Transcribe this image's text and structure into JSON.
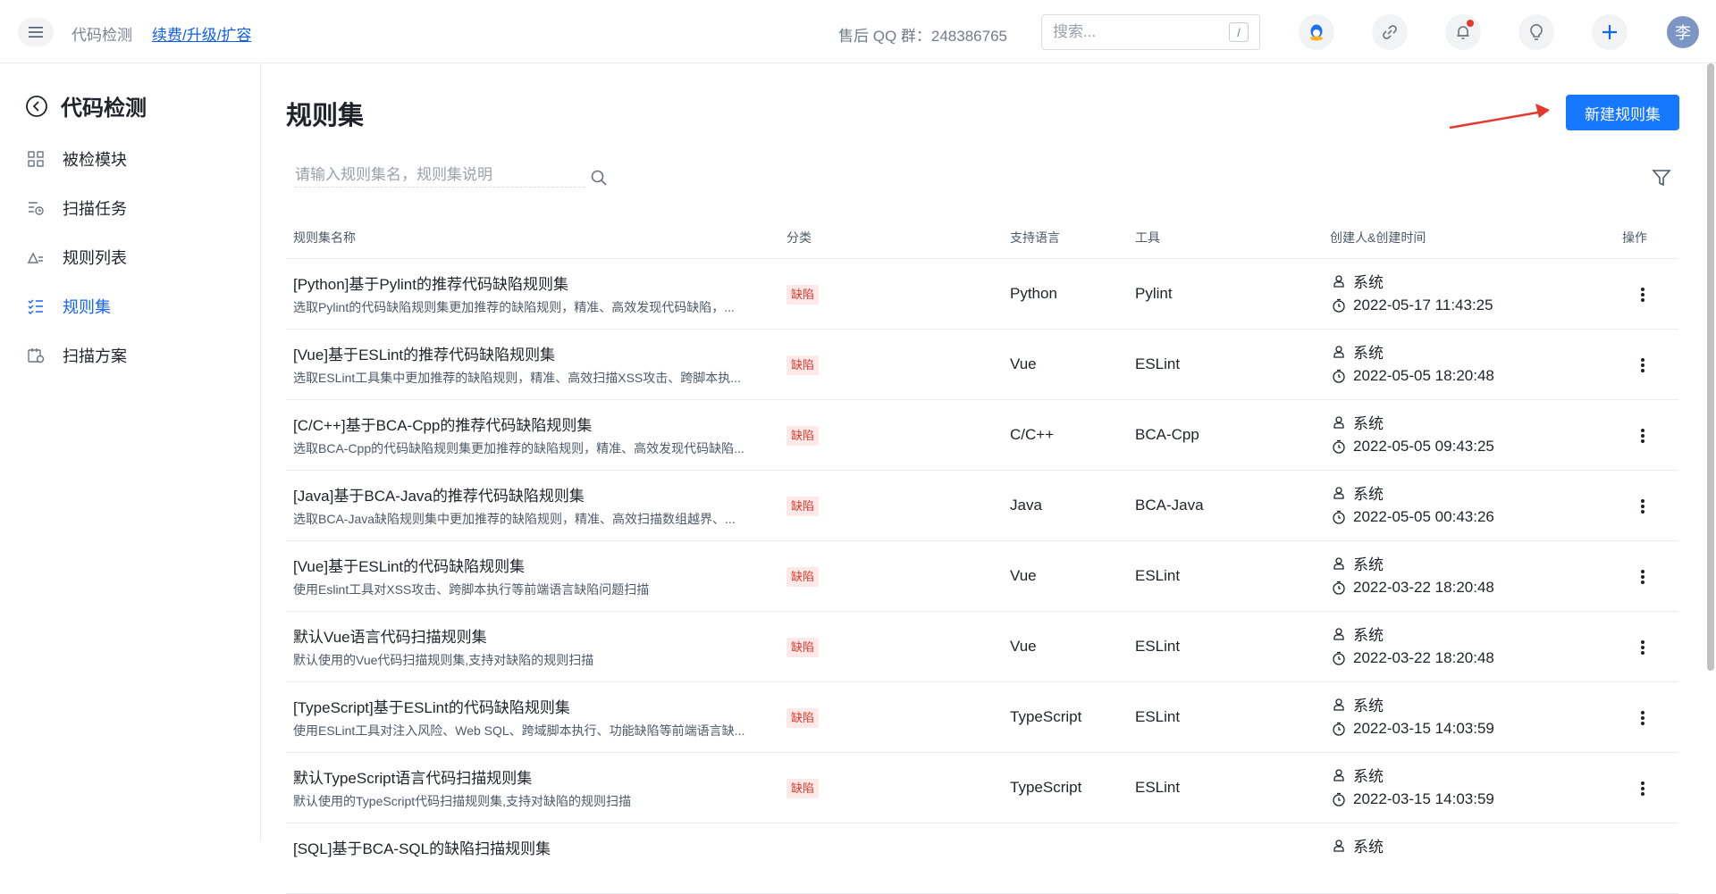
{
  "header": {
    "breadcrumb_root": "代码检测",
    "breadcrumb_link": "续费/升级/扩容",
    "qq_group": "售后 QQ 群：248386765",
    "search_placeholder": "搜索...",
    "search_shortcut": "/",
    "avatar_text": "李",
    "icons": [
      "qq-icon",
      "link-icon",
      "bell-icon",
      "bulb-icon",
      "plus-icon"
    ]
  },
  "sidebar": {
    "title": "代码检测",
    "items": [
      {
        "label": "被检模块",
        "icon": "grid-icon"
      },
      {
        "label": "扫描任务",
        "icon": "task-icon"
      },
      {
        "label": "规则列表",
        "icon": "rules-icon"
      },
      {
        "label": "规则集",
        "icon": "ruleset-icon",
        "active": true
      },
      {
        "label": "扫描方案",
        "icon": "plan-icon"
      }
    ]
  },
  "main": {
    "title": "规则集",
    "new_button": "新建规则集",
    "search_placeholder": "请输入规则集名，规则集说明",
    "columns": {
      "name": "规则集名称",
      "category": "分类",
      "language": "支持语言",
      "tool": "工具",
      "creator": "创建人&创建时间",
      "ops": "操作"
    },
    "rows": [
      {
        "name": "[Python]基于Pylint的推荐代码缺陷规则集",
        "desc": "选取Pylint的代码缺陷规则集更加推荐的缺陷规则，精准、高效发现代码缺陷，...",
        "tag": "缺陷",
        "lang": "Python",
        "tool": "Pylint",
        "creator": "系统",
        "time": "2022-05-17 11:43:25"
      },
      {
        "name": "[Vue]基于ESLint的推荐代码缺陷规则集",
        "desc": "选取ESLint工具集中更加推荐的缺陷规则，精准、高效扫描XSS攻击、跨脚本执...",
        "tag": "缺陷",
        "lang": "Vue",
        "tool": "ESLint",
        "creator": "系统",
        "time": "2022-05-05 18:20:48"
      },
      {
        "name": "[C/C++]基于BCA-Cpp的推荐代码缺陷规则集",
        "desc": "选取BCA-Cpp的代码缺陷规则集更加推荐的缺陷规则，精准、高效发现代码缺陷...",
        "tag": "缺陷",
        "lang": "C/C++",
        "tool": "BCA-Cpp",
        "creator": "系统",
        "time": "2022-05-05 09:43:25"
      },
      {
        "name": "[Java]基于BCA-Java的推荐代码缺陷规则集",
        "desc": "选取BCA-Java缺陷规则集中更加推荐的缺陷规则，精准、高效扫描数组越界、...",
        "tag": "缺陷",
        "lang": "Java",
        "tool": "BCA-Java",
        "creator": "系统",
        "time": "2022-05-05 00:43:26"
      },
      {
        "name": "[Vue]基于ESLint的代码缺陷规则集",
        "desc": "使用Eslint工具对XSS攻击、跨脚本执行等前端语言缺陷问题扫描",
        "tag": "缺陷",
        "lang": "Vue",
        "tool": "ESLint",
        "creator": "系统",
        "time": "2022-03-22 18:20:48"
      },
      {
        "name": "默认Vue语言代码扫描规则集",
        "desc": "默认使用的Vue代码扫描规则集,支持对缺陷的规则扫描",
        "tag": "缺陷",
        "lang": "Vue",
        "tool": "ESLint",
        "creator": "系统",
        "time": "2022-03-22 18:20:48"
      },
      {
        "name": "[TypeScript]基于ESLint的代码缺陷规则集",
        "desc": "使用ESLint工具对注入风险、Web SQL、跨域脚本执行、功能缺陷等前端语言缺...",
        "tag": "缺陷",
        "lang": "TypeScript",
        "tool": "ESLint",
        "creator": "系统",
        "time": "2022-03-15 14:03:59"
      },
      {
        "name": "默认TypeScript语言代码扫描规则集",
        "desc": "默认使用的TypeScript代码扫描规则集,支持对缺陷的规则扫描",
        "tag": "缺陷",
        "lang": "TypeScript",
        "tool": "ESLint",
        "creator": "系统",
        "time": "2022-03-15 14:03:59"
      },
      {
        "name": "[SQL]基于BCA-SQL的缺陷扫描规则集",
        "desc": "",
        "tag": "",
        "lang": "",
        "tool": "",
        "creator": "系统",
        "time": ""
      }
    ]
  }
}
